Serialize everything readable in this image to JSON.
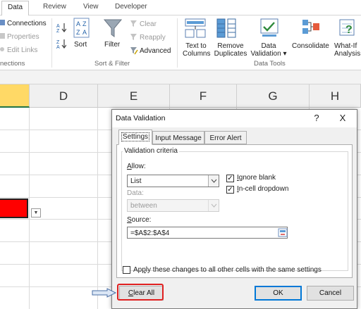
{
  "ribbon": {
    "tabs": [
      "Data",
      "Review",
      "View",
      "Developer"
    ],
    "active_tab": "Data",
    "connections": {
      "items": [
        "Connections",
        "Properties",
        "Edit Links"
      ],
      "group_label": "nections"
    },
    "sort_filter": {
      "sort_label": "Sort",
      "filter_label": "Filter",
      "clear_label": "Clear",
      "reapply_label": "Reapply",
      "advanced_label": "Advanced",
      "group_label": "Sort & Filter"
    },
    "data_tools": {
      "text_to_columns": [
        "Text to",
        "Columns"
      ],
      "remove_duplicates": [
        "Remove",
        "Duplicates"
      ],
      "data_validation": [
        "Data",
        "Validation ▾"
      ],
      "consolidate": "Consolidate",
      "what_if": [
        "What-If",
        "Analysis"
      ],
      "group_label": "Data Tools"
    }
  },
  "sheet": {
    "columns": [
      "D",
      "E",
      "F",
      "G",
      "H"
    ],
    "selected_cell_color": "#ff0000"
  },
  "dialog": {
    "title": "Data Validation",
    "help_button": "?",
    "close_button": "X",
    "tabs": [
      "Settings",
      "Input Message",
      "Error Alert"
    ],
    "active_tab": "Settings",
    "legend": "Validation criteria",
    "allow": {
      "label_pre": "",
      "label_key": "A",
      "label_post": "llow:",
      "value": "List"
    },
    "data": {
      "label": "Data:",
      "value": "between"
    },
    "ignore_blank": {
      "checked": true,
      "label_pre": "",
      "label_key": "I",
      "label_post": "gnore blank"
    },
    "in_cell_dropdown": {
      "checked": true,
      "label_pre": "",
      "label_key": "I",
      "label_post": "n-cell dropdown"
    },
    "source": {
      "label_pre": "",
      "label_key": "S",
      "label_post": "ource:",
      "value": "=$A$2:$A$4"
    },
    "apply_all": {
      "checked": false,
      "label_pre": "Ap",
      "label_key": "p",
      "label_post": "ly these changes to all other cells with the same settings"
    },
    "clear_all": {
      "label_pre": "",
      "label_key": "C",
      "label_post": "lear All"
    },
    "ok": "OK",
    "cancel": "Cancel"
  },
  "colors": {
    "excel_green": "#217346",
    "highlight": "#e02020",
    "default_button": "#0078d7",
    "selected_column": "#ffd966"
  },
  "icons": [
    "sort-az-icon",
    "sort-za-icon",
    "filter-funnel-icon",
    "text-to-columns-icon",
    "remove-duplicates-icon",
    "data-validation-icon",
    "consolidate-icon",
    "what-if-icon",
    "range-selector-icon",
    "annotation-arrow-icon"
  ]
}
